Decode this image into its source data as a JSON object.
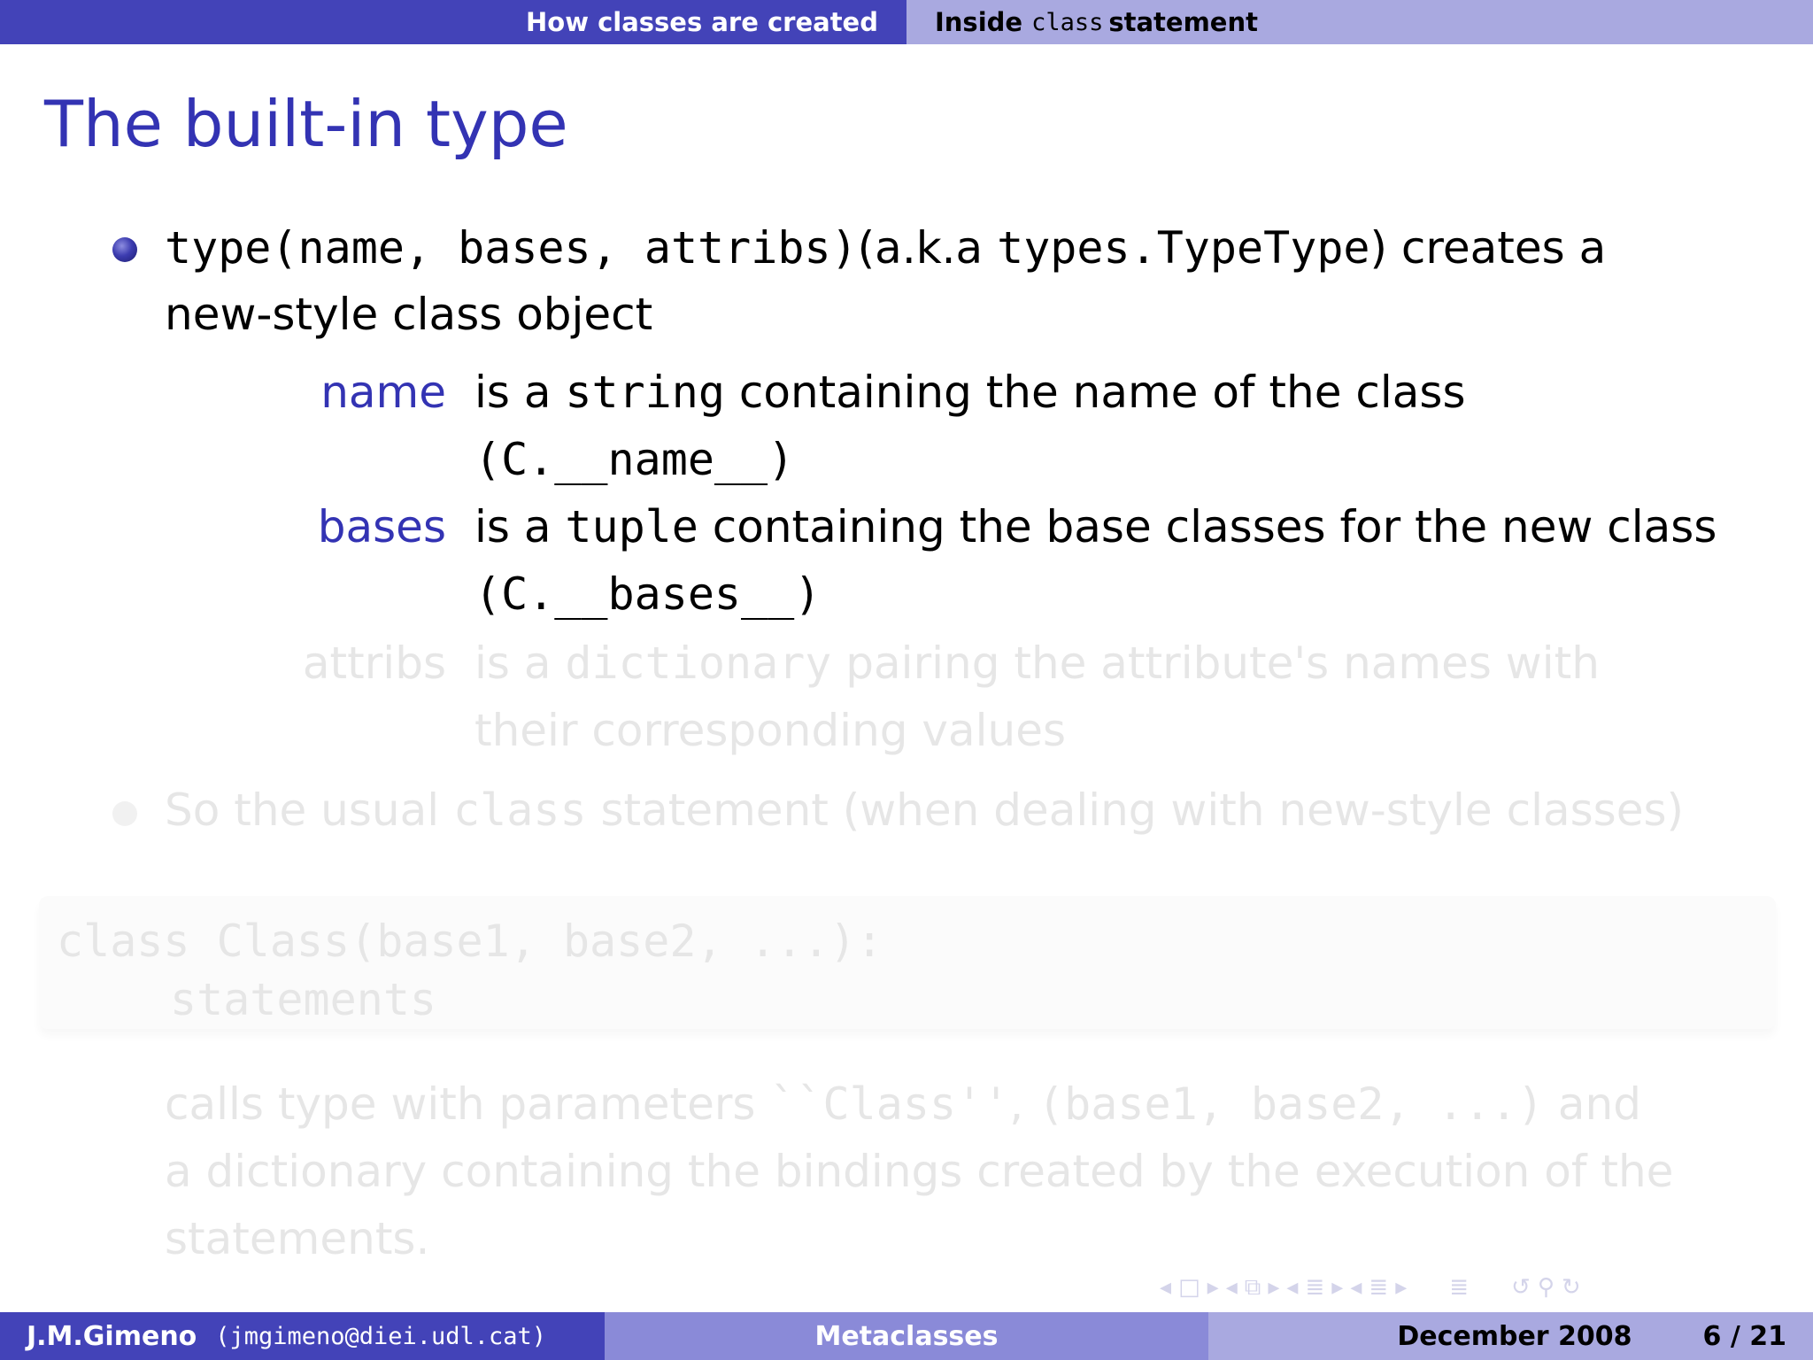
{
  "header": {
    "section_left": "How classes are created",
    "section_right_pre": "Inside",
    "section_right_code": "class",
    "section_right_post": "statement"
  },
  "slide": {
    "title": "The built-in type",
    "bullet1": {
      "code": "type(name, bases, attribs)",
      "text_a": "(a.k.a ",
      "code2": "types.TypeType",
      "text_b": ") creates a",
      "line2": "new-style class object"
    },
    "defs": [
      {
        "term": "name",
        "pre": "is a ",
        "code": "string",
        "post": " containing the name of the class",
        "line2": "(C.__name__)"
      },
      {
        "term": "bases",
        "pre": "is a ",
        "code": "tuple",
        "post": " containing the base classes for the new class",
        "line2": "(C.__bases__)"
      },
      {
        "term": "attribs",
        "pre": "is a ",
        "code": "dictionary",
        "post": " pairing the attribute's names with",
        "line2": "their corresponding values"
      }
    ],
    "bullet2": {
      "text_a": "So the usual ",
      "code": "class",
      "text_b": " statement (when dealing with new-style classes)"
    },
    "code_block": {
      "line1": "class Class(base1, base2, ...):",
      "line2": "statements"
    },
    "para": {
      "l1_a": "calls type with parameters ",
      "l1_code": "``Class''",
      "l1_b": ", ",
      "l1_code2": "(base1, base2, ...)",
      "l1_c": " and",
      "l2": "a dictionary containing the bindings created by the execution of the",
      "l3": "statements."
    }
  },
  "nav_symbols": [
    "◂",
    "□",
    "▸",
    "◂",
    "⧉",
    "▸",
    "◂",
    "≣",
    "▸",
    "◂",
    "≣",
    "▸",
    "≣",
    "↺",
    "⚲",
    "↻"
  ],
  "footer": {
    "author": "J.M.Gimeno",
    "email": "(jmgimeno@diei.udl.cat)",
    "talk": "Metaclasses",
    "date": "December 2008",
    "page": "6 / 21"
  }
}
